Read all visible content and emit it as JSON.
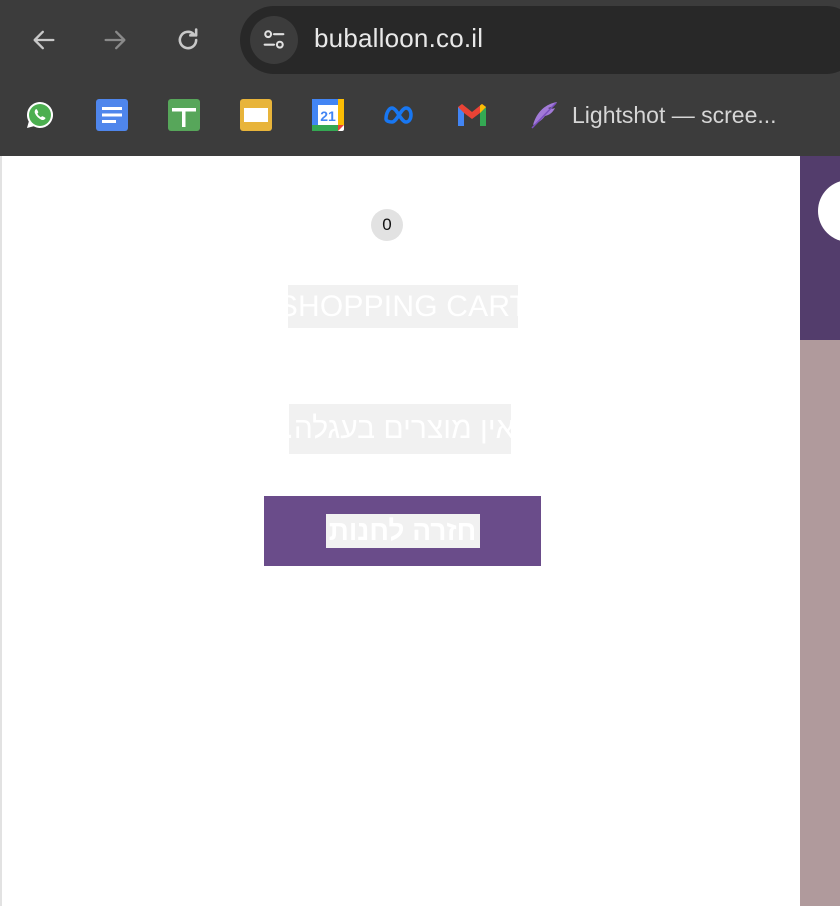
{
  "browser": {
    "url": "buballoon.co.il",
    "nav": {
      "back": "back-arrow-icon",
      "forward": "forward-arrow-icon",
      "reload": "reload-icon",
      "site_info": "site-settings-icon"
    },
    "bookmarks": [
      {
        "name": "whatsapp",
        "icon": "whatsapp-icon",
        "label": ""
      },
      {
        "name": "google-docs",
        "icon": "google-docs-icon",
        "label": ""
      },
      {
        "name": "google-sheets",
        "icon": "google-sheets-icon",
        "label": ""
      },
      {
        "name": "google-slides",
        "icon": "google-slides-icon",
        "label": ""
      },
      {
        "name": "google-calendar",
        "icon": "google-calendar-icon",
        "label": "",
        "calendar_day": "21"
      },
      {
        "name": "meta",
        "icon": "meta-icon",
        "label": ""
      },
      {
        "name": "gmail",
        "icon": "gmail-icon",
        "label": ""
      },
      {
        "name": "lightshot",
        "icon": "feather-icon",
        "label": "Lightshot — scree..."
      }
    ]
  },
  "cart": {
    "count": "0",
    "title": "SHOPPING CART",
    "empty_message": "אין מוצרים בעגלה.",
    "return_button": "חזרה לחנות"
  },
  "colors": {
    "brand_purple": "#6a4c8a",
    "header_purple": "#533d6c",
    "side_panel": "#b09a9c",
    "chrome_bg": "#3c3c3c"
  }
}
